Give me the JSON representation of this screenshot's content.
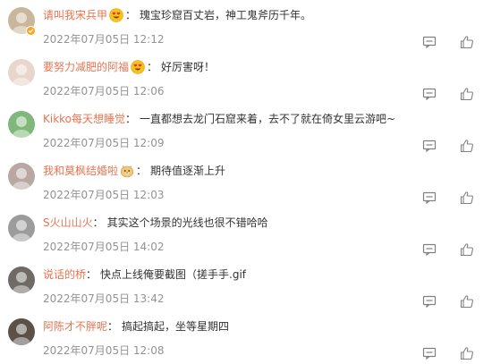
{
  "comments": [
    {
      "username": "请叫我宋兵甲",
      "emoji_before": "heart-eyes-emoji",
      "content": "瑰宝珍窟百丈岩，神工鬼斧历千年。",
      "timestamp": "2022年07月05日 12:12",
      "likes": "",
      "verified": true,
      "avatar_color": "#c9b79c"
    },
    {
      "username": "要努力减肥的阿福",
      "emoji_before": "heart-eyes-emoji",
      "content": "好厉害呀！",
      "timestamp": "2022年07月05日 12:06",
      "likes": "",
      "verified": false,
      "avatar_color": "#e8d6cc"
    },
    {
      "username": "Kikko每天想睡觉",
      "emoji_before": "",
      "content": "一直都想去龙门石窟来着，去不了就在倚女里云游吧~",
      "timestamp": "2022年07月05日 12:09",
      "likes": "",
      "verified": false,
      "avatar_color": "#7fb87a"
    },
    {
      "username": "我和莫枫结婚啦",
      "emoji_before": "doge-emoji",
      "content": "期待值逐渐上升",
      "timestamp": "2022年07月05日 12:03",
      "likes": "",
      "verified": false,
      "avatar_color": "#b9a7a3"
    },
    {
      "username": "S火山山火",
      "emoji_before": "",
      "content": "其实这个场景的光线也很不错哈哈",
      "timestamp": "2022年07月05日 14:02",
      "likes": "",
      "verified": false,
      "avatar_color": "#9c9c9c"
    },
    {
      "username": "说话的桥",
      "emoji_before": "",
      "content": "快点上线俺要截图（搓手手.gif",
      "timestamp": "2022年07月05日 13:42",
      "likes": "",
      "verified": false,
      "avatar_color": "#6f6a63"
    },
    {
      "username": "阿陈才不胖呢",
      "emoji_before": "",
      "content": "搞起搞起，坐等星期四",
      "timestamp": "2022年07月05日 12:08",
      "likes": "",
      "verified": false,
      "avatar_color": "#5a5148"
    }
  ],
  "colors": {
    "username": "#eb7350",
    "text": "#333333",
    "timestamp": "#939393",
    "icon": "#808080"
  },
  "icons": {
    "reply": "comment-icon",
    "like": "thumbs-up-icon"
  }
}
